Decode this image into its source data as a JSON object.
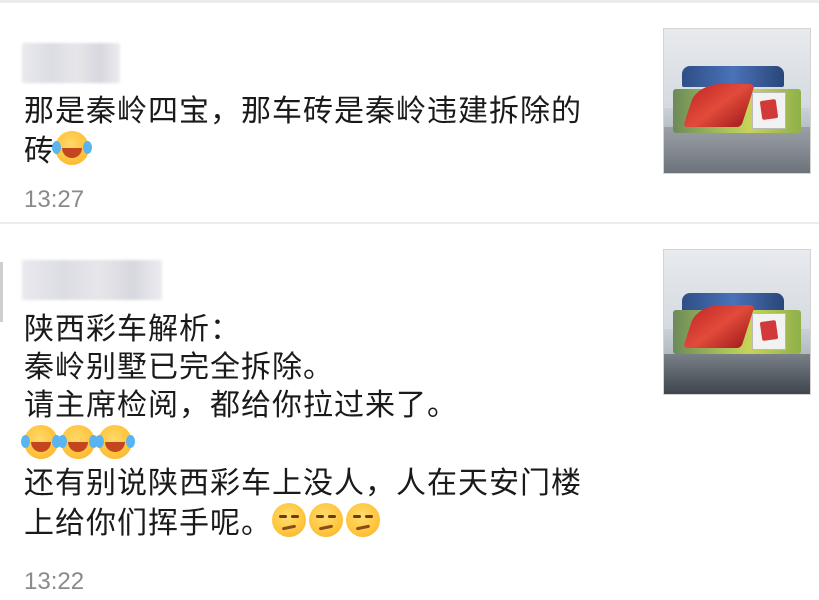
{
  "messages": [
    {
      "sender": "",
      "lines": [
        "那是秦岭四宝，那车砖是秦岭违建拆除的",
        "砖"
      ],
      "emojis": [
        "laugh"
      ],
      "time": "13:27"
    },
    {
      "sender": "",
      "lines": [
        "陕西彩车解析：",
        "秦岭别墅已完全拆除。",
        "请主席检阅，都给你拉过来了。",
        "还有别说陕西彩车上没人，人在天安门楼",
        "上给你们挥手呢。"
      ],
      "emoji_row": [
        "laugh",
        "laugh",
        "laugh"
      ],
      "trailing_emojis": [
        "smirk",
        "smirk",
        "smirk"
      ],
      "time": "13:22"
    }
  ],
  "colors": {
    "text": "#1a1a1a",
    "time": "#8a8a8a",
    "divider": "#ececec"
  }
}
